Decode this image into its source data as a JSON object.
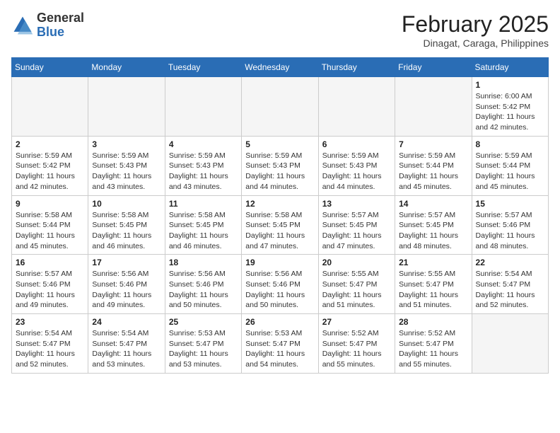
{
  "header": {
    "logo_general": "General",
    "logo_blue": "Blue",
    "month_title": "February 2025",
    "location": "Dinagat, Caraga, Philippines"
  },
  "calendar": {
    "days_of_week": [
      "Sunday",
      "Monday",
      "Tuesday",
      "Wednesday",
      "Thursday",
      "Friday",
      "Saturday"
    ],
    "weeks": [
      [
        {
          "day": "",
          "info": ""
        },
        {
          "day": "",
          "info": ""
        },
        {
          "day": "",
          "info": ""
        },
        {
          "day": "",
          "info": ""
        },
        {
          "day": "",
          "info": ""
        },
        {
          "day": "",
          "info": ""
        },
        {
          "day": "1",
          "info": "Sunrise: 6:00 AM\nSunset: 5:42 PM\nDaylight: 11 hours\nand 42 minutes."
        }
      ],
      [
        {
          "day": "2",
          "info": "Sunrise: 5:59 AM\nSunset: 5:42 PM\nDaylight: 11 hours\nand 42 minutes."
        },
        {
          "day": "3",
          "info": "Sunrise: 5:59 AM\nSunset: 5:43 PM\nDaylight: 11 hours\nand 43 minutes."
        },
        {
          "day": "4",
          "info": "Sunrise: 5:59 AM\nSunset: 5:43 PM\nDaylight: 11 hours\nand 43 minutes."
        },
        {
          "day": "5",
          "info": "Sunrise: 5:59 AM\nSunset: 5:43 PM\nDaylight: 11 hours\nand 44 minutes."
        },
        {
          "day": "6",
          "info": "Sunrise: 5:59 AM\nSunset: 5:43 PM\nDaylight: 11 hours\nand 44 minutes."
        },
        {
          "day": "7",
          "info": "Sunrise: 5:59 AM\nSunset: 5:44 PM\nDaylight: 11 hours\nand 45 minutes."
        },
        {
          "day": "8",
          "info": "Sunrise: 5:59 AM\nSunset: 5:44 PM\nDaylight: 11 hours\nand 45 minutes."
        }
      ],
      [
        {
          "day": "9",
          "info": "Sunrise: 5:58 AM\nSunset: 5:44 PM\nDaylight: 11 hours\nand 45 minutes."
        },
        {
          "day": "10",
          "info": "Sunrise: 5:58 AM\nSunset: 5:45 PM\nDaylight: 11 hours\nand 46 minutes."
        },
        {
          "day": "11",
          "info": "Sunrise: 5:58 AM\nSunset: 5:45 PM\nDaylight: 11 hours\nand 46 minutes."
        },
        {
          "day": "12",
          "info": "Sunrise: 5:58 AM\nSunset: 5:45 PM\nDaylight: 11 hours\nand 47 minutes."
        },
        {
          "day": "13",
          "info": "Sunrise: 5:57 AM\nSunset: 5:45 PM\nDaylight: 11 hours\nand 47 minutes."
        },
        {
          "day": "14",
          "info": "Sunrise: 5:57 AM\nSunset: 5:45 PM\nDaylight: 11 hours\nand 48 minutes."
        },
        {
          "day": "15",
          "info": "Sunrise: 5:57 AM\nSunset: 5:46 PM\nDaylight: 11 hours\nand 48 minutes."
        }
      ],
      [
        {
          "day": "16",
          "info": "Sunrise: 5:57 AM\nSunset: 5:46 PM\nDaylight: 11 hours\nand 49 minutes."
        },
        {
          "day": "17",
          "info": "Sunrise: 5:56 AM\nSunset: 5:46 PM\nDaylight: 11 hours\nand 49 minutes."
        },
        {
          "day": "18",
          "info": "Sunrise: 5:56 AM\nSunset: 5:46 PM\nDaylight: 11 hours\nand 50 minutes."
        },
        {
          "day": "19",
          "info": "Sunrise: 5:56 AM\nSunset: 5:46 PM\nDaylight: 11 hours\nand 50 minutes."
        },
        {
          "day": "20",
          "info": "Sunrise: 5:55 AM\nSunset: 5:47 PM\nDaylight: 11 hours\nand 51 minutes."
        },
        {
          "day": "21",
          "info": "Sunrise: 5:55 AM\nSunset: 5:47 PM\nDaylight: 11 hours\nand 51 minutes."
        },
        {
          "day": "22",
          "info": "Sunrise: 5:54 AM\nSunset: 5:47 PM\nDaylight: 11 hours\nand 52 minutes."
        }
      ],
      [
        {
          "day": "23",
          "info": "Sunrise: 5:54 AM\nSunset: 5:47 PM\nDaylight: 11 hours\nand 52 minutes."
        },
        {
          "day": "24",
          "info": "Sunrise: 5:54 AM\nSunset: 5:47 PM\nDaylight: 11 hours\nand 53 minutes."
        },
        {
          "day": "25",
          "info": "Sunrise: 5:53 AM\nSunset: 5:47 PM\nDaylight: 11 hours\nand 53 minutes."
        },
        {
          "day": "26",
          "info": "Sunrise: 5:53 AM\nSunset: 5:47 PM\nDaylight: 11 hours\nand 54 minutes."
        },
        {
          "day": "27",
          "info": "Sunrise: 5:52 AM\nSunset: 5:47 PM\nDaylight: 11 hours\nand 55 minutes."
        },
        {
          "day": "28",
          "info": "Sunrise: 5:52 AM\nSunset: 5:47 PM\nDaylight: 11 hours\nand 55 minutes."
        },
        {
          "day": "",
          "info": ""
        }
      ]
    ]
  }
}
